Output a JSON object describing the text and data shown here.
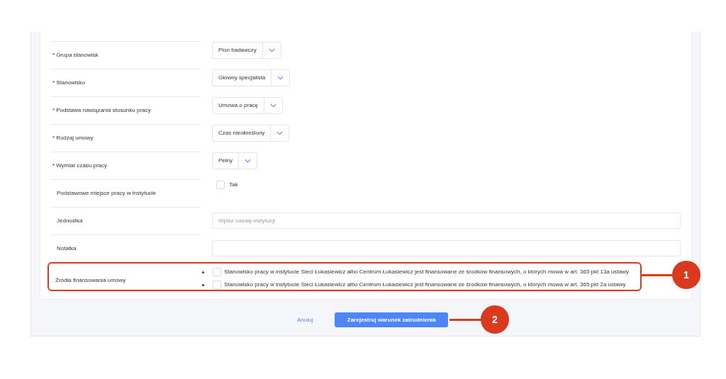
{
  "fields": [
    {
      "kind": "select",
      "marker": "*",
      "label": "Grupa stanowisk",
      "value": "Pion badawczy"
    },
    {
      "kind": "select",
      "marker": "*",
      "label": "Stanowisko",
      "value": "Główny specjalista"
    },
    {
      "kind": "select",
      "marker": "*",
      "label": "Podstawa nawiązania stosunku pracy",
      "value": "Umowa o pracę"
    },
    {
      "kind": "select",
      "marker": "*",
      "label": "Rodzaj umowy",
      "value": "Czas nieokreślony"
    },
    {
      "kind": "select",
      "marker": "*",
      "label": "Wymiar czasu pracy",
      "value": "Pełny"
    },
    {
      "kind": "checkbox",
      "label": "Podstawowe miejsce pracy w instytucie",
      "option": "Tak",
      "checked": false
    },
    {
      "kind": "text",
      "label": "Jednostka",
      "placeholder": "Wpisz nazwę instytucji"
    },
    {
      "kind": "text",
      "label": "Notatka"
    }
  ],
  "funding": {
    "label": "Źródła finansowania umowy",
    "options": [
      {
        "text": "Stanowisko pracy w instytucie Sieci Łukasiewicz albo Centrum Łukasiewicz jest finansowane ze środków finansowych, o których mowa w art. 365 pkt 13a ustawy",
        "checked": false
      },
      {
        "text": "Stanowisko pracy w instytucie Sieci Łukasiewicz albo Centrum Łukasiewicz jest finansowane ze środków finansowych, o których mowa w art. 365 pkt 2a ustawy",
        "checked": false
      }
    ]
  },
  "actions": {
    "cancel": "Anuluj",
    "submit": "Zarejestruj warunek zatrudnienia"
  },
  "callouts": [
    "1",
    "2"
  ]
}
